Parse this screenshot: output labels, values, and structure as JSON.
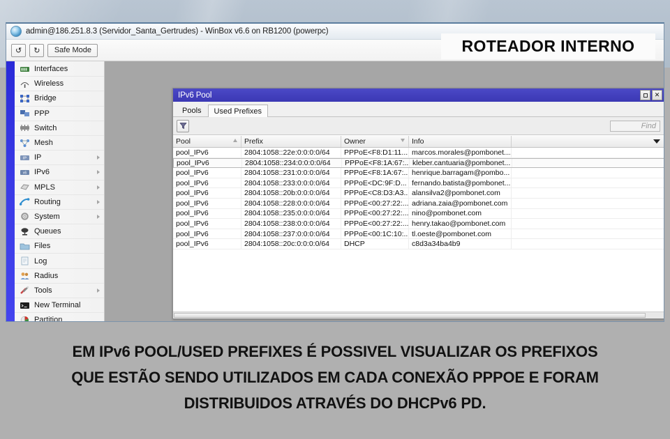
{
  "window": {
    "title": "admin@186.251.8.3 (Servidor_Santa_Gertrudes) - WinBox v6.6 on RB1200 (powerpc)",
    "logo_icon": "winbox-globe-icon",
    "toolbar": {
      "undo_label": "↺",
      "redo_label": "↻",
      "safe_mode_label": "Safe Mode"
    }
  },
  "sidebar": {
    "items": [
      {
        "label": "Interfaces",
        "icon": "interfaces-icon",
        "arrow": false
      },
      {
        "label": "Wireless",
        "icon": "wireless-icon",
        "arrow": false
      },
      {
        "label": "Bridge",
        "icon": "bridge-icon",
        "arrow": false
      },
      {
        "label": "PPP",
        "icon": "ppp-icon",
        "arrow": false
      },
      {
        "label": "Switch",
        "icon": "switch-icon",
        "arrow": false
      },
      {
        "label": "Mesh",
        "icon": "mesh-icon",
        "arrow": false
      },
      {
        "label": "IP",
        "icon": "ip-icon",
        "arrow": true
      },
      {
        "label": "IPv6",
        "icon": "ipv6-icon",
        "arrow": true
      },
      {
        "label": "MPLS",
        "icon": "mpls-icon",
        "arrow": true
      },
      {
        "label": "Routing",
        "icon": "routing-icon",
        "arrow": true
      },
      {
        "label": "System",
        "icon": "system-gear-icon",
        "arrow": true
      },
      {
        "label": "Queues",
        "icon": "queues-icon",
        "arrow": false
      },
      {
        "label": "Files",
        "icon": "files-folder-icon",
        "arrow": false
      },
      {
        "label": "Log",
        "icon": "log-icon",
        "arrow": false
      },
      {
        "label": "Radius",
        "icon": "radius-icon",
        "arrow": false
      },
      {
        "label": "Tools",
        "icon": "tools-icon",
        "arrow": true
      },
      {
        "label": "New Terminal",
        "icon": "terminal-icon",
        "arrow": false
      },
      {
        "label": "Partition",
        "icon": "partition-icon",
        "arrow": false
      }
    ]
  },
  "child_window": {
    "title": "IPv6 Pool",
    "maximize_icon": "maximize-icon",
    "close_icon": "close-icon",
    "tabs": [
      {
        "label": "Pools",
        "active": false
      },
      {
        "label": "Used Prefixes",
        "active": true
      }
    ],
    "filter_icon": "filter-funnel-icon",
    "find_placeholder": "Find",
    "column_menu_icon": "chevron-down-icon",
    "table": {
      "columns": [
        {
          "label": "Pool",
          "sort": "asc"
        },
        {
          "label": "Prefix",
          "sort": "none"
        },
        {
          "label": "Owner",
          "sort": "desc"
        },
        {
          "label": "Info",
          "sort": "none"
        }
      ],
      "rows": [
        {
          "pool": "pool_IPv6",
          "prefix": "2804:1058::22e:0:0:0:0/64",
          "owner": "PPPoE<F8:D1:11...",
          "info": "marcos.morales@pombonet....",
          "selected": false
        },
        {
          "pool": "pool_IPv6",
          "prefix": "2804:1058::234:0:0:0:0/64",
          "owner": "PPPoE<F8:1A:67:...",
          "info": "kleber.cantuaria@pombonet...",
          "selected": true
        },
        {
          "pool": "pool_IPv6",
          "prefix": "2804:1058::231:0:0:0:0/64",
          "owner": "PPPoE<F8:1A:67:...",
          "info": "henrique.barragam@pombo...",
          "selected": false
        },
        {
          "pool": "pool_IPv6",
          "prefix": "2804:1058::233:0:0:0:0/64",
          "owner": "PPPoE<DC:9F:D...",
          "info": "fernando.batista@pombonet...",
          "selected": false
        },
        {
          "pool": "pool_IPv6",
          "prefix": "2804:1058::20b:0:0:0:0/64",
          "owner": "PPPoE<C8:D3:A3...",
          "info": "alansilva2@pombonet.com",
          "selected": false
        },
        {
          "pool": "pool_IPv6",
          "prefix": "2804:1058::228:0:0:0:0/64",
          "owner": "PPPoE<00:27:22:...",
          "info": "adriana.zaia@pombonet.com",
          "selected": false
        },
        {
          "pool": "pool_IPv6",
          "prefix": "2804:1058::235:0:0:0:0/64",
          "owner": "PPPoE<00:27:22:...",
          "info": "nino@pombonet.com",
          "selected": false
        },
        {
          "pool": "pool_IPv6",
          "prefix": "2804:1058::238:0:0:0:0/64",
          "owner": "PPPoE<00:27:22:...",
          "info": "henry.takao@pombonet.com",
          "selected": false
        },
        {
          "pool": "pool_IPv6",
          "prefix": "2804:1058::237:0:0:0:0/64",
          "owner": "PPPoE<00:1C:10:...",
          "info": "tl.oeste@pombonet.com",
          "selected": false
        },
        {
          "pool": "pool_IPv6",
          "prefix": "2804:1058::20c:0:0:0:0/64",
          "owner": "DHCP",
          "info": "c8d3a34ba4b9",
          "selected": false
        }
      ]
    }
  },
  "banner": {
    "text": "ROTEADOR INTERNO"
  },
  "caption": {
    "lines": [
      "EM IPv6 POOL/USED PREFIXES É POSSIVEL VISUALIZAR OS PREFIXOS",
      "QUE ESTÃO SENDO UTILIZADOS EM CADA CONEXÃO PPPOE E FORAM",
      "DISTRIBUIDOS ATRAVÉS DO DHCPv6 PD."
    ]
  },
  "colors": {
    "child_title_bar": "#4340bd",
    "sidebar_accent": "#3a3ae6",
    "workspace": "#a6a6a6",
    "caption_background": "#b0b0b0",
    "desktop": "#b4c1ce"
  }
}
